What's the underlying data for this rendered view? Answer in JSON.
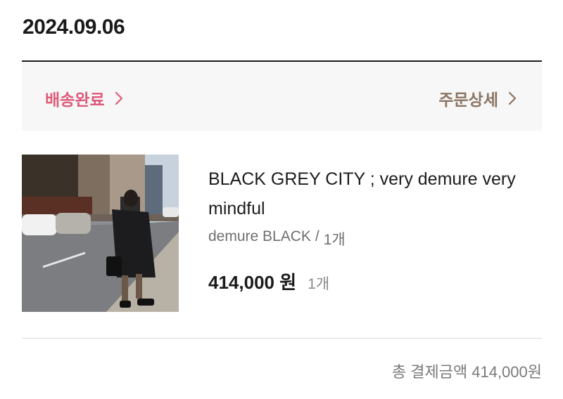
{
  "order": {
    "date": "2024.09.06"
  },
  "status": {
    "label": "배송완료",
    "accent": "#dd5b7a",
    "detail_label": "주문상세",
    "detail_color": "#8c7463"
  },
  "product": {
    "name": "BLACK GREY CITY ; very demure very mindful",
    "option": "demure BLACK",
    "option_separator": "/",
    "option_qty": "1개",
    "price": "414,000 원",
    "qty": "1개"
  },
  "summary": {
    "label": "총 결제금액",
    "amount": "414,000원"
  },
  "icons": {
    "status_chevron": "chevron-right-icon",
    "detail_chevron": "chevron-right-icon"
  }
}
